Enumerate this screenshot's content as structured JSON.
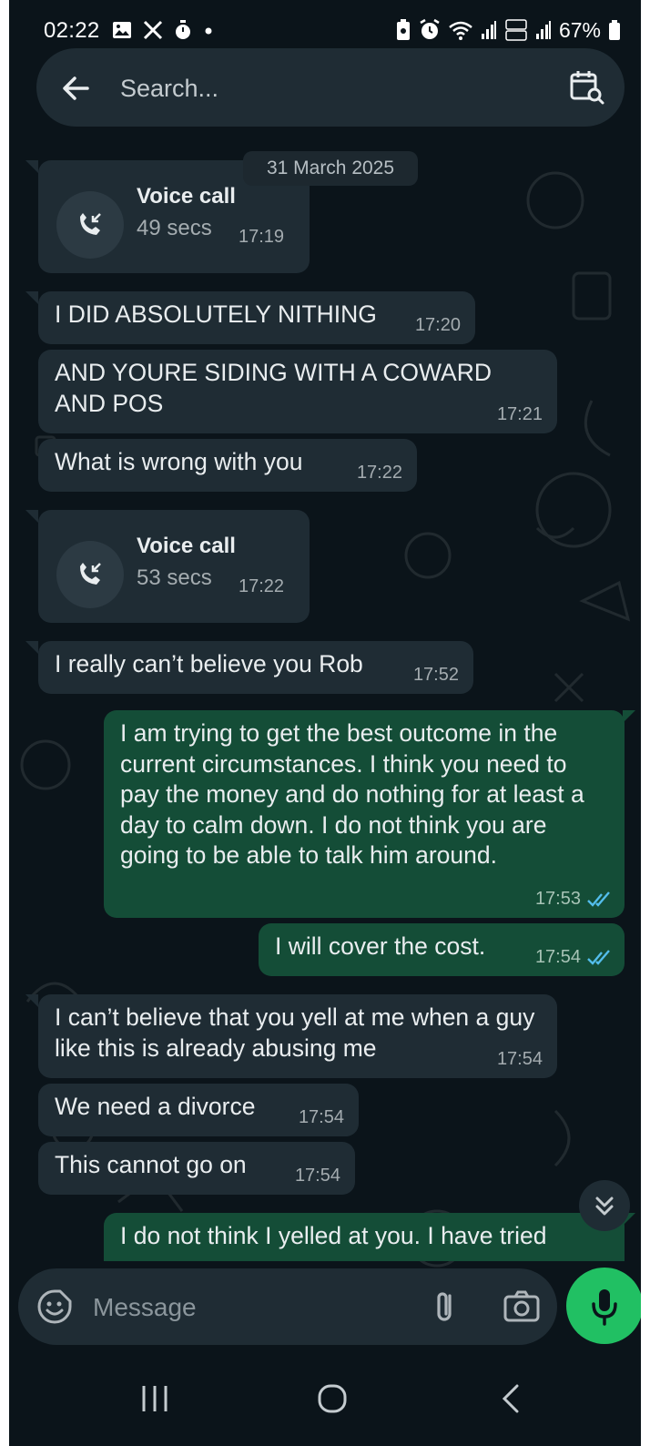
{
  "status_bar": {
    "time": "02:22",
    "left_icons": [
      "image-icon",
      "x-icon",
      "stopwatch-icon",
      "dot-icon"
    ],
    "right_icons": [
      "battery-saver-icon",
      "alarm-icon",
      "wifi-icon",
      "signal-icon",
      "volte-lte2-icon",
      "signal-icon",
      "battery-icon"
    ],
    "battery": "67%"
  },
  "search": {
    "placeholder": "Search..."
  },
  "chat": {
    "date_label": "31 March 2025",
    "voice_calls": [
      {
        "title": "Voice call",
        "duration": "49 secs",
        "time": "17:19",
        "direction": "incoming"
      },
      {
        "title": "Voice call",
        "duration": "53 secs",
        "time": "17:22",
        "direction": "incoming"
      }
    ],
    "messages": [
      {
        "text": "I DID ABSOLUTELY NITHING",
        "time": "17:20",
        "direction": "in"
      },
      {
        "text": "AND YOURE SIDING WITH A COWARD AND POS",
        "time": "17:21",
        "direction": "in"
      },
      {
        "text": "What is wrong with you",
        "time": "17:22",
        "direction": "in"
      },
      {
        "text": "I really can’t believe you Rob",
        "time": "17:52",
        "direction": "in"
      },
      {
        "text": "I am trying to get the best outcome in the current circumstances. I think you need to pay the money and do nothing for at least a day to calm down. I do not think you are going to be able to talk him around.",
        "time": "17:53",
        "direction": "out",
        "status": "read"
      },
      {
        "text": "I will cover the cost.",
        "time": "17:54",
        "direction": "out",
        "status": "read"
      },
      {
        "text": "I can’t believe that you yell at me when a guy like this is already abusing me",
        "time": "17:54",
        "direction": "in"
      },
      {
        "text": "We need a divorce",
        "time": "17:54",
        "direction": "in"
      },
      {
        "text": "This cannot go on",
        "time": "17:54",
        "direction": "in"
      },
      {
        "text": "I do not think I yelled at you. I have tried",
        "time": "",
        "direction": "out",
        "partial": true
      }
    ]
  },
  "composer": {
    "placeholder": "Message"
  },
  "colors": {
    "background": "#0b141a",
    "incoming_bubble": "#1f2c34",
    "outgoing_bubble": "#144d37",
    "accent": "#21c063",
    "read_ticks": "#53bdeb"
  }
}
